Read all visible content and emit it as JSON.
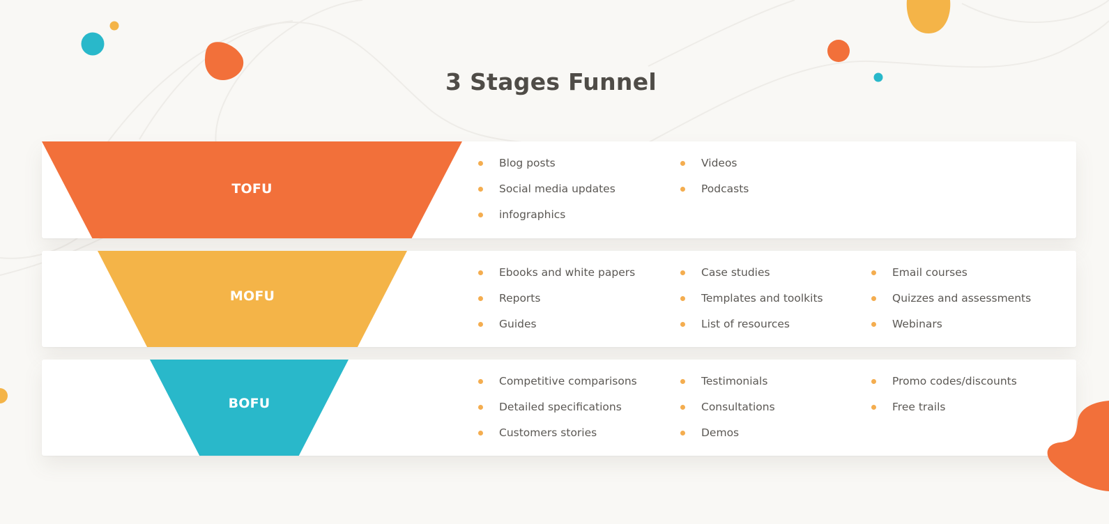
{
  "title": "3 Stages Funnel",
  "colors": {
    "tofu": "#f2703a",
    "mofu": "#f4b448",
    "bofu": "#29b8ca",
    "bullet": "#f4ad4f",
    "text": "#5b5854",
    "title": "#4f4c47",
    "background": "#f9f8f5"
  },
  "stages": [
    {
      "label": "TOFU",
      "columns": [
        [
          "Blog posts",
          "Social media updates",
          "infographics"
        ],
        [
          "Videos",
          "Podcasts"
        ],
        []
      ]
    },
    {
      "label": "MOFU",
      "columns": [
        [
          "Ebooks and white papers",
          "Reports",
          "Guides"
        ],
        [
          "Case studies",
          "Templates and toolkits",
          "List of resources"
        ],
        [
          "Email courses",
          "Quizzes and assessments",
          "Webinars"
        ]
      ]
    },
    {
      "label": "BOFU",
      "columns": [
        [
          "Competitive comparisons",
          "Detailed specifications",
          "Customers stories"
        ],
        [
          "Testimonials",
          "Consultations",
          "Demos"
        ],
        [
          "Promo codes/discounts",
          "Free trails"
        ]
      ]
    }
  ]
}
